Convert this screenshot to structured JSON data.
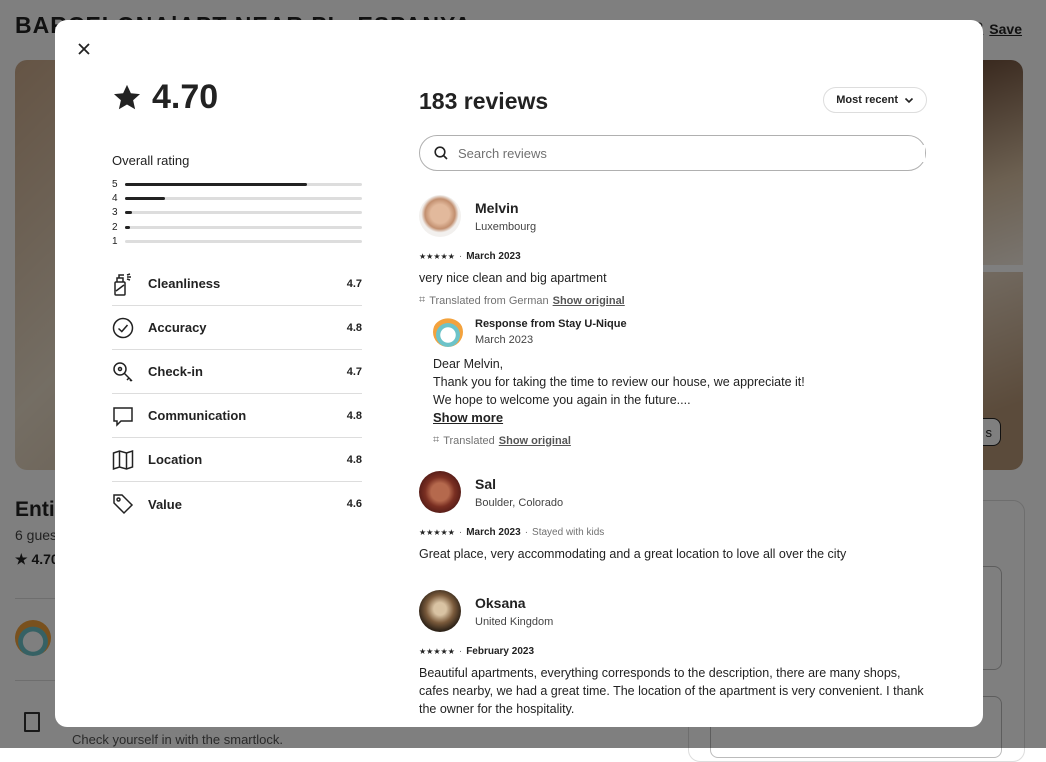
{
  "background": {
    "title": "BARCELONA|APT NEAR PL. ESPANYA",
    "save_label": "Save",
    "show_photos_label": "s",
    "listing_title": "Entir",
    "guests": "6 gues",
    "rating": "4.70",
    "checkin_text": "Check yourself in with the smartlock."
  },
  "modal": {
    "rating": "4.70",
    "overall_label": "Overall rating",
    "distribution": [
      {
        "stars": "5",
        "fraction": 0.77
      },
      {
        "stars": "4",
        "fraction": 0.17
      },
      {
        "stars": "3",
        "fraction": 0.03
      },
      {
        "stars": "2",
        "fraction": 0.02
      },
      {
        "stars": "1",
        "fraction": 0.0
      }
    ],
    "categories": [
      {
        "label": "Cleanliness",
        "score": "4.7",
        "icon": "spray-icon"
      },
      {
        "label": "Accuracy",
        "score": "4.8",
        "icon": "check-circle-icon"
      },
      {
        "label": "Check-in",
        "score": "4.7",
        "icon": "key-icon"
      },
      {
        "label": "Communication",
        "score": "4.8",
        "icon": "chat-icon"
      },
      {
        "label": "Location",
        "score": "4.8",
        "icon": "map-icon"
      },
      {
        "label": "Value",
        "score": "4.6",
        "icon": "tag-icon"
      }
    ],
    "reviews_title": "183 reviews",
    "sort_label": "Most recent",
    "search_placeholder": "Search reviews",
    "reviews": [
      {
        "name": "Melvin",
        "location": "Luxembourg",
        "stars": "★★★★★",
        "date": "March 2023",
        "extra": "",
        "text": "very nice clean and big apartment",
        "translated": "Translated from German",
        "show_original": "Show original",
        "response": {
          "title": "Response from Stay U-Nique",
          "date": "March 2023",
          "lines": [
            "Dear Melvin,",
            "Thank you for taking the time to review our house, we appreciate it!",
            "We hope to welcome you again in the future...."
          ],
          "show_more": "Show more",
          "translated": "Translated",
          "show_original": "Show original"
        }
      },
      {
        "name": "Sal",
        "location": "Boulder, Colorado",
        "stars": "★★★★★",
        "date": "March 2023",
        "extra": "Stayed with kids",
        "text": "Great place, very accommodating and a great location to love all over the city"
      },
      {
        "name": "Oksana",
        "location": "United Kingdom",
        "stars": "★★★★★",
        "date": "February 2023",
        "extra": "",
        "text": "Beautiful apartments, everything corresponds to the description, there are many shops, cafes nearby, we had a great time. The location of the apartment is very convenient. I thank the owner for the hospitality."
      }
    ]
  }
}
